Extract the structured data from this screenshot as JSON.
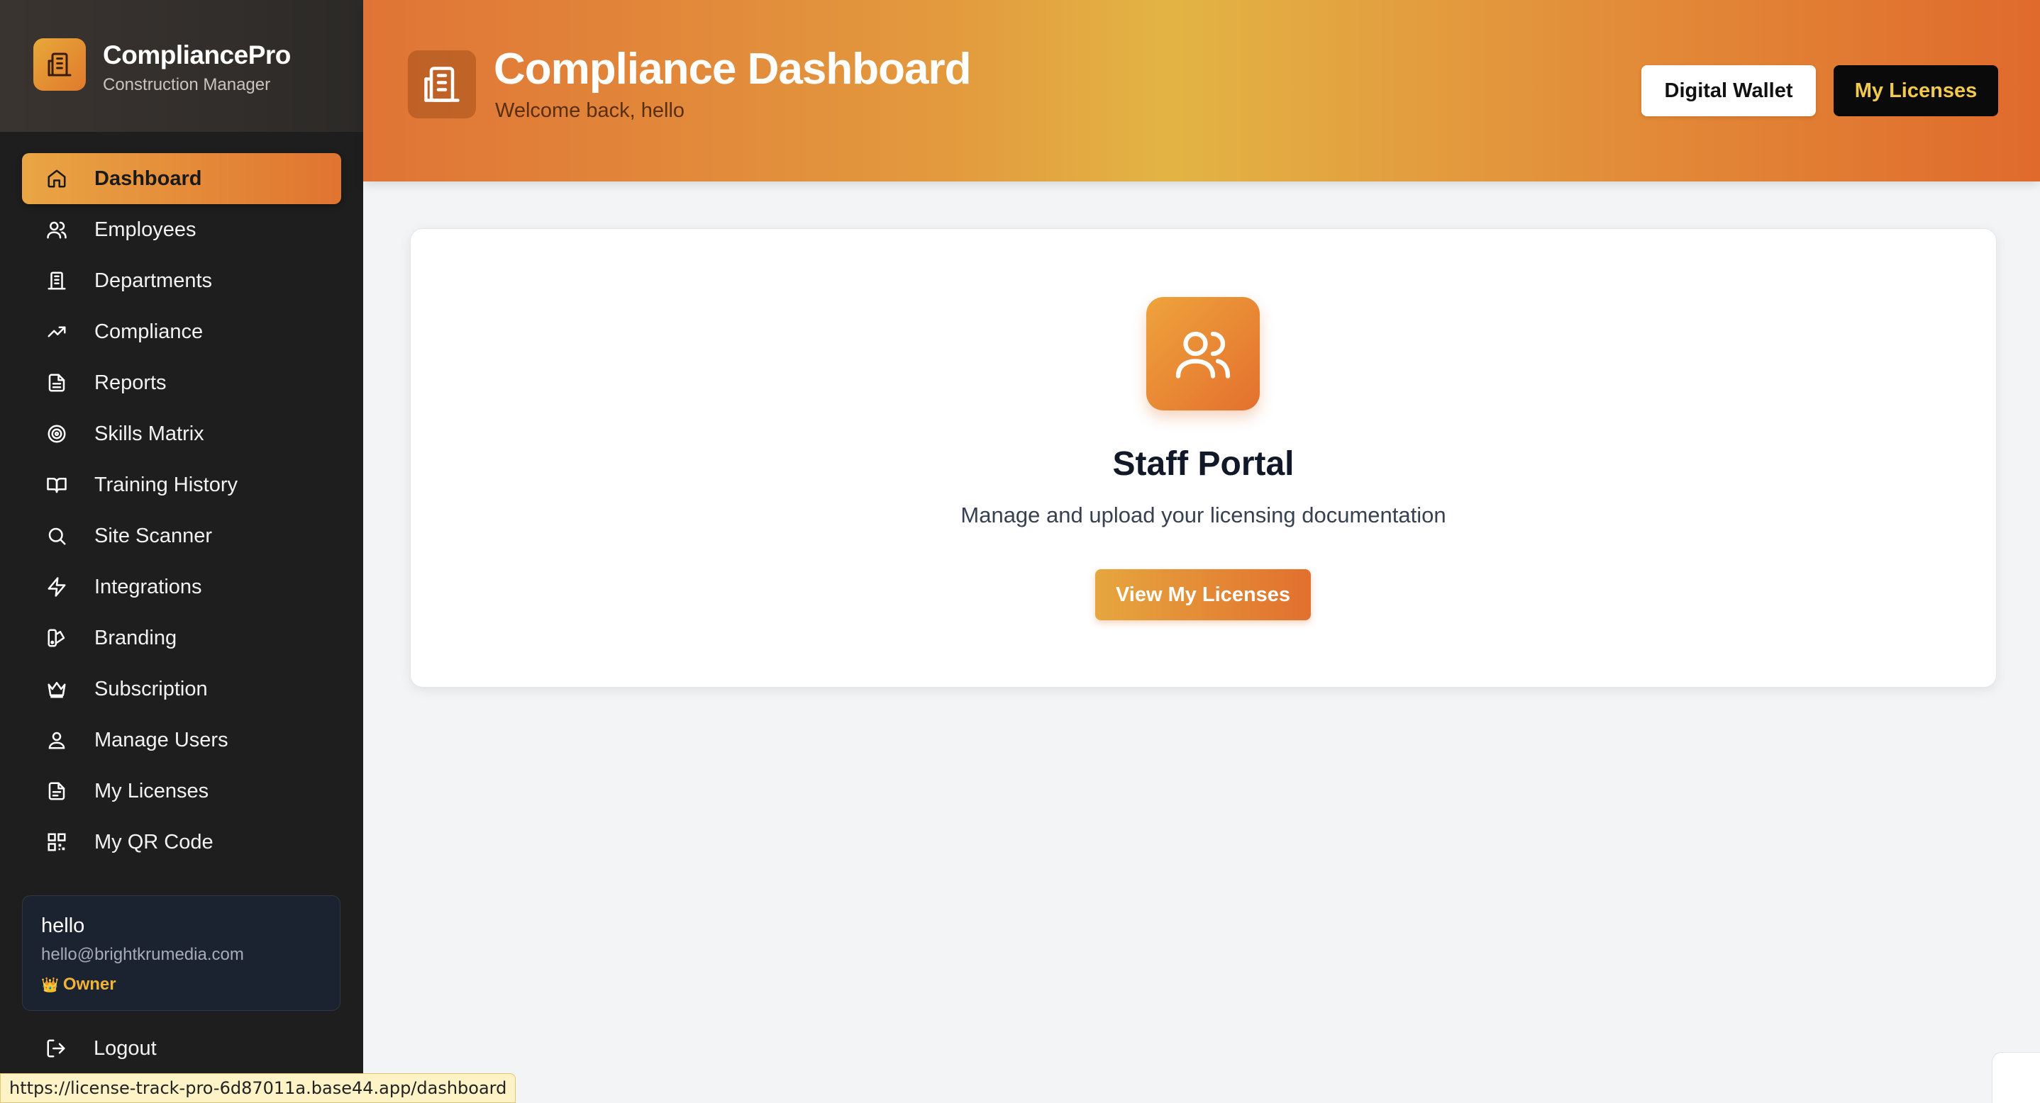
{
  "brand": {
    "name": "CompliancePro",
    "subtitle": "Construction Manager"
  },
  "sidebar": {
    "items": [
      {
        "label": "Dashboard",
        "icon": "home-icon",
        "active": true
      },
      {
        "label": "Employees",
        "icon": "users-icon"
      },
      {
        "label": "Departments",
        "icon": "building-icon"
      },
      {
        "label": "Compliance",
        "icon": "trending-up-icon"
      },
      {
        "label": "Reports",
        "icon": "file-text-icon"
      },
      {
        "label": "Skills Matrix",
        "icon": "target-icon"
      },
      {
        "label": "Training History",
        "icon": "book-open-icon"
      },
      {
        "label": "Site Scanner",
        "icon": "search-icon"
      },
      {
        "label": "Integrations",
        "icon": "zap-icon"
      },
      {
        "label": "Branding",
        "icon": "palette-icon"
      },
      {
        "label": "Subscription",
        "icon": "crown-icon"
      },
      {
        "label": "Manage Users",
        "icon": "user-cog-icon"
      },
      {
        "label": "My Licenses",
        "icon": "file-icon"
      },
      {
        "label": "My QR Code",
        "icon": "qr-code-icon"
      }
    ],
    "user": {
      "name": "hello",
      "email": "hello@brightkrumedia.com",
      "role": "Owner",
      "role_icon": "👑"
    },
    "logout_label": "Logout"
  },
  "header": {
    "title": "Compliance Dashboard",
    "subtitle": "Welcome back, hello",
    "wallet_button": "Digital Wallet",
    "licenses_button": "My Licenses"
  },
  "card": {
    "title": "Staff Portal",
    "description": "Manage and upload your licensing documentation",
    "button": "View My Licenses"
  },
  "status_bar": {
    "url": "https://license-track-pro-6d87011a.base44.app/dashboard"
  },
  "colors": {
    "accent": "#e39a3e",
    "accent_dark": "#e07430",
    "sidebar_bg": "#1e1e1e",
    "gold_text": "#f2c94c"
  }
}
